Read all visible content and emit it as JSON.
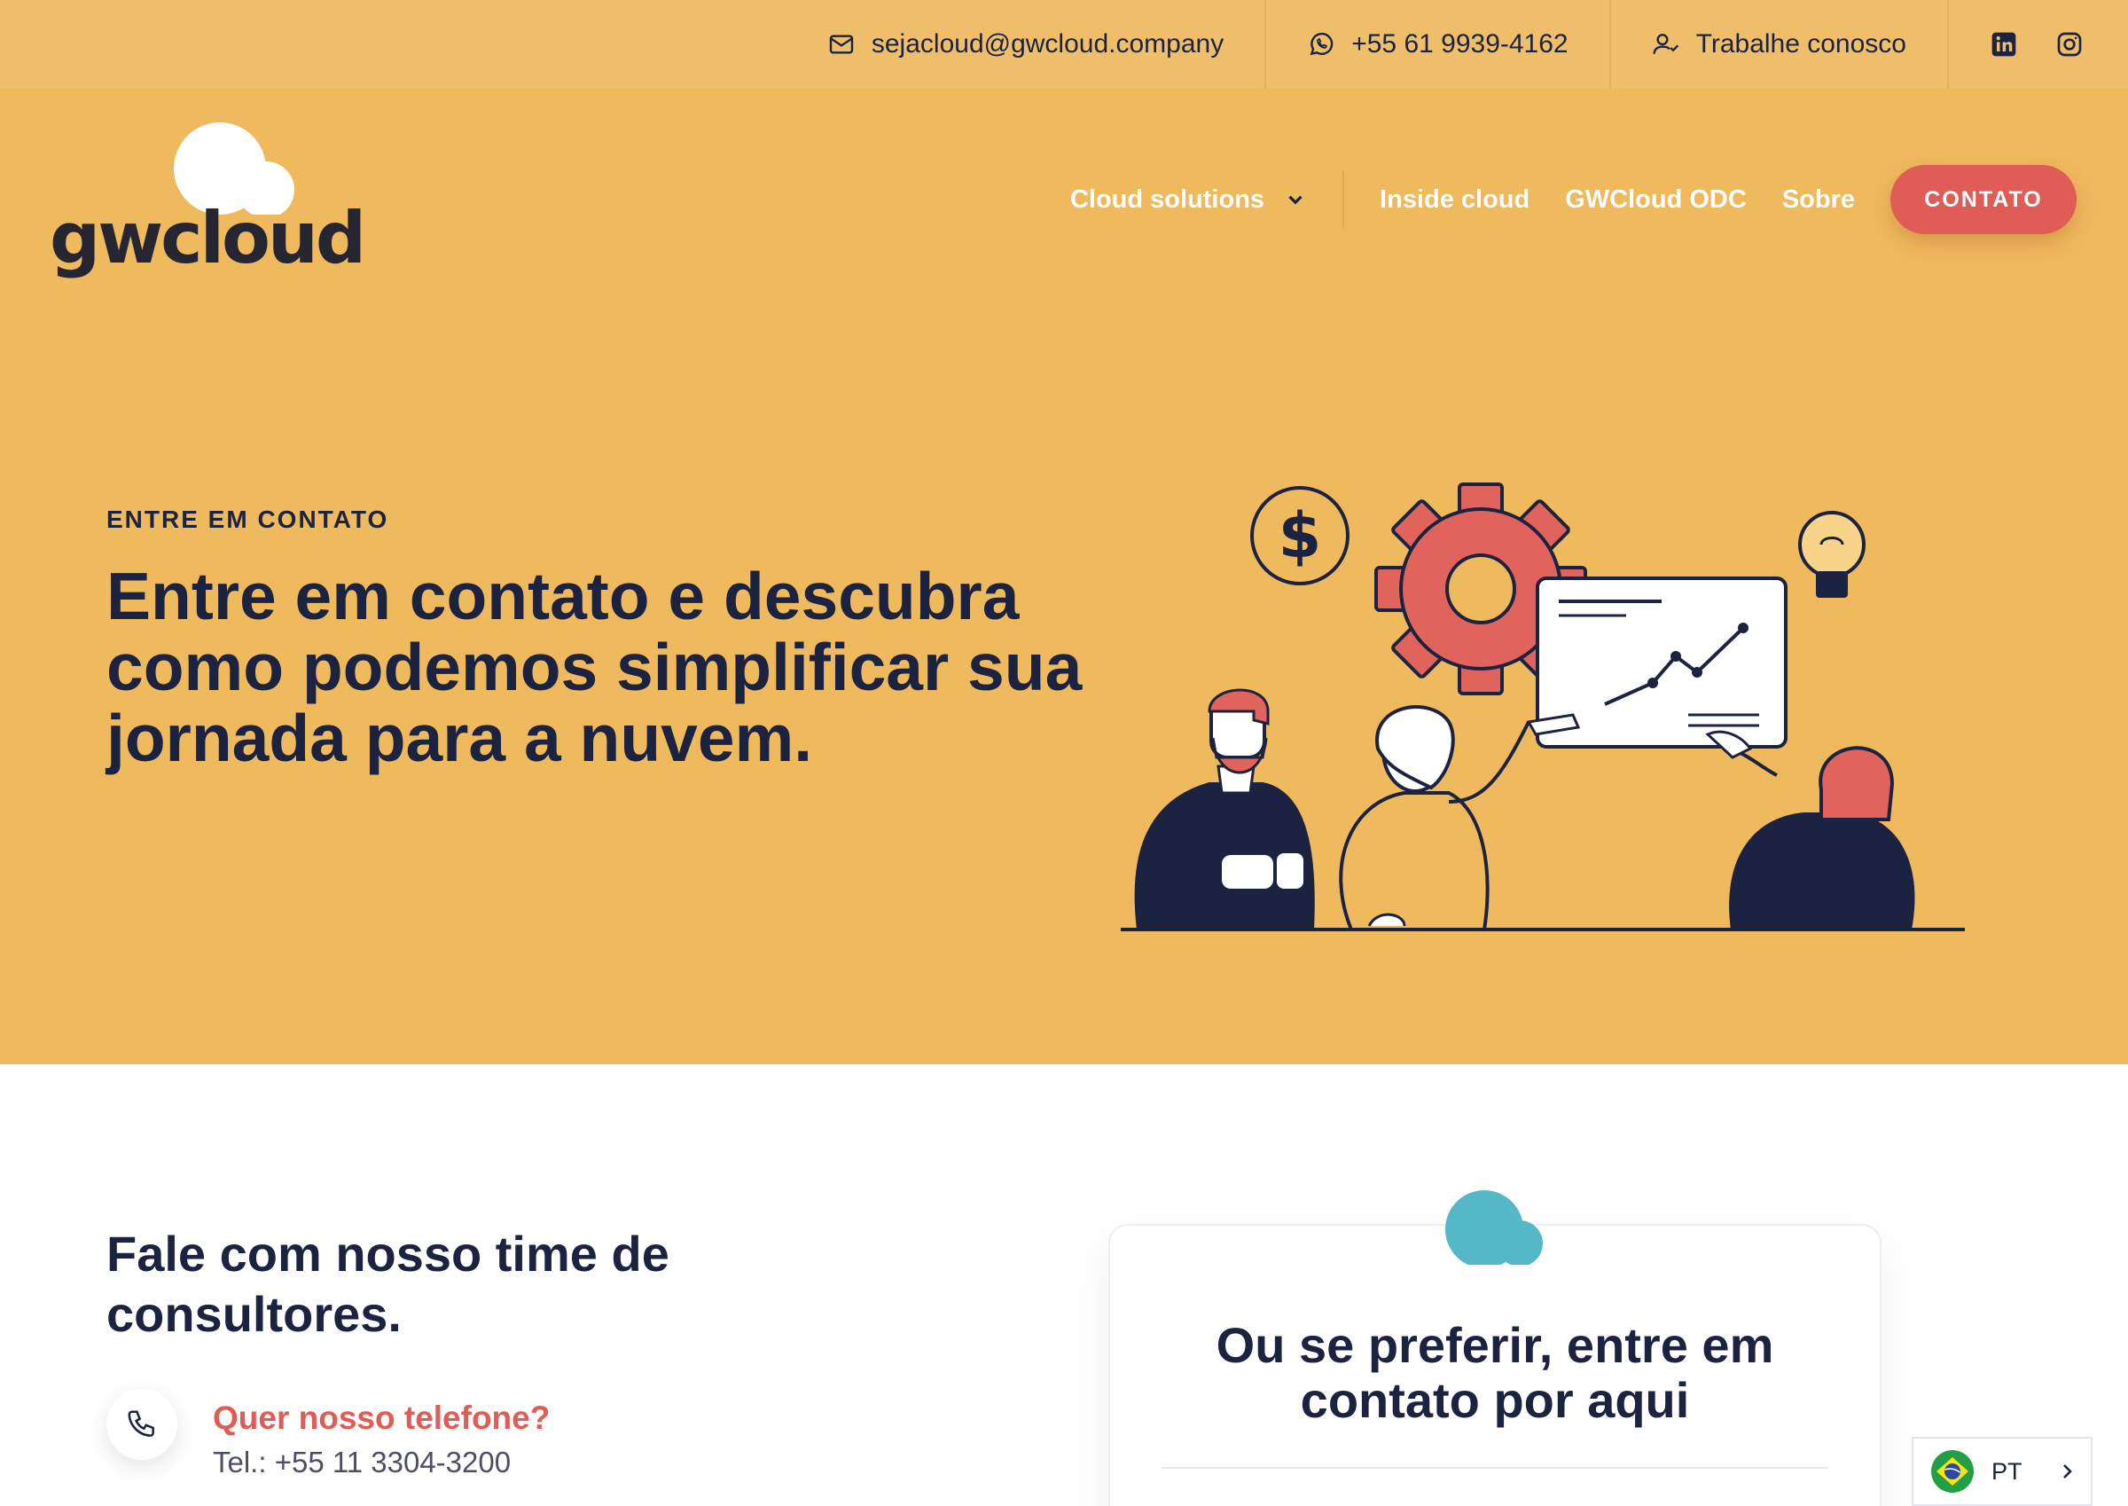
{
  "topbar": {
    "email": "sejacloud@gwcloud.company",
    "phone": "+55 61 9939-4162",
    "careers": "Trabalhe conosco",
    "social": [
      "linkedin-icon",
      "instagram-icon"
    ]
  },
  "brand": {
    "logo_text": "gwcloud"
  },
  "nav": {
    "items": [
      "Cloud solutions",
      "Inside cloud",
      "GWCloud ODC",
      "Sobre"
    ],
    "cta": "CONTATO"
  },
  "hero": {
    "eyebrow": "ENTRE EM CONTATO",
    "title": "Entre em contato e descubra como podemos simplificar sua jornada para a nuvem."
  },
  "consultants": {
    "title": "Fale com nosso time de consultores.",
    "phone_question": "Quer nosso telefone?",
    "phone_number": "Tel.: +55 11 3304-3200"
  },
  "form_card": {
    "title": "Ou se preferir, entre em contato por aqui"
  },
  "language": {
    "label": "PT"
  },
  "colors": {
    "topbar_bg": "#efbe6b",
    "hero_bg": "#efb95e",
    "navy": "#1b2340",
    "coral": "#e05d57",
    "teal": "#54b8c6"
  }
}
